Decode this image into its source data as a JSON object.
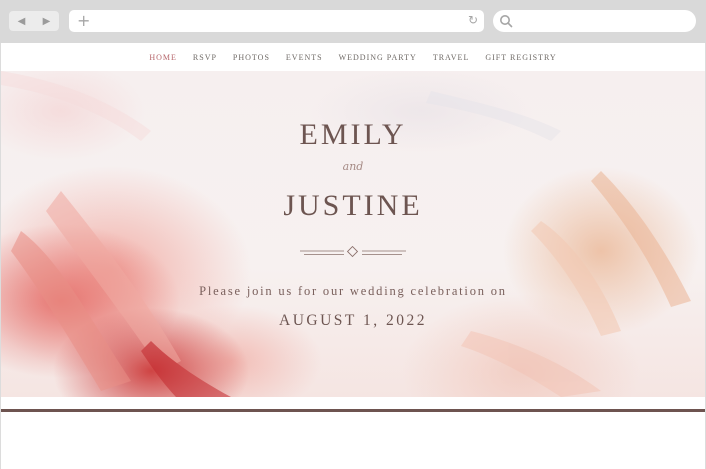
{
  "browser": {
    "back_icon": "back-arrow-icon",
    "forward_icon": "forward-arrow-icon",
    "back_glyph": "◀",
    "forward_glyph": "▶",
    "new_tab_glyph": "+",
    "reload_glyph": "↻",
    "search_icon": "search-icon"
  },
  "nav": {
    "items": [
      "HOME",
      "RSVP",
      "PHOTOS",
      "EVENTS",
      "WEDDING PARTY",
      "TRAVEL",
      "GIFT REGISTRY"
    ],
    "active": "HOME",
    "active_color": "#b5656a"
  },
  "hero": {
    "name1": "EMILY",
    "connector": "and",
    "name2": "JUSTINE",
    "invitation": "Please join us for our wedding celebration on",
    "date": "AUGUST 1, 2022",
    "text_color": "#6d5551",
    "rule_color": "#6e5450"
  }
}
